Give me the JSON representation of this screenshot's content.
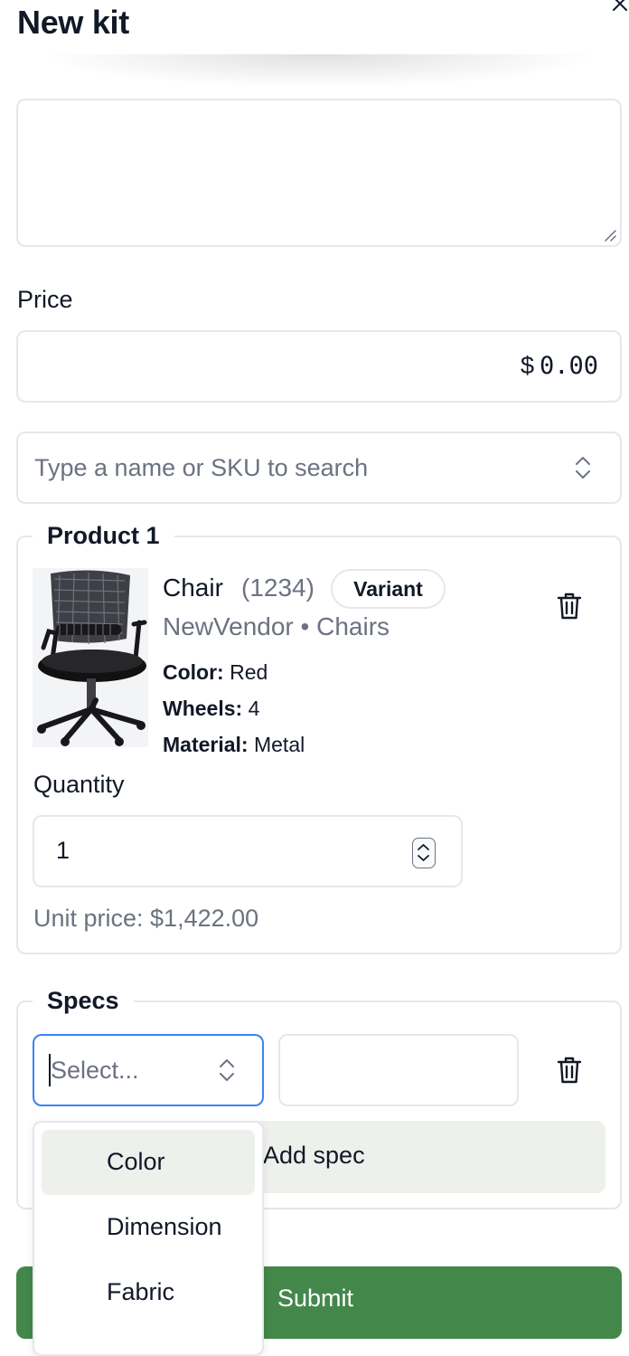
{
  "header": {
    "title": "New kit"
  },
  "price": {
    "label": "Price",
    "currency": "$",
    "value": "0.00"
  },
  "search": {
    "placeholder": "Type a name or SKU to search"
  },
  "product": {
    "legend": "Product 1",
    "name": "Chair",
    "sku": "(1234)",
    "badge": "Variant",
    "vendor_category": "NewVendor • Chairs",
    "attributes": [
      {
        "key": "Color:",
        "value": "Red"
      },
      {
        "key": "Wheels:",
        "value": "4"
      },
      {
        "key": "Material:",
        "value": "Metal"
      }
    ],
    "quantity_label": "Quantity",
    "quantity": "1",
    "unit_price": "Unit price: $1,422.00"
  },
  "specs": {
    "legend": "Specs",
    "select_placeholder": "Select...",
    "add_label": "Add spec",
    "options": [
      "Color",
      "Dimension",
      "Fabric"
    ],
    "highlighted_option": "Color"
  },
  "submit": {
    "label": "Submit"
  },
  "colors": {
    "accent_focus": "#3b82f6",
    "submit_green": "#43874a",
    "muted_text": "#6b7280",
    "border": "#e5e7eb"
  },
  "icons": [
    "close-icon",
    "resize-handle-icon",
    "chevron-updown-icon",
    "trash-icon",
    "stepper-icon"
  ]
}
